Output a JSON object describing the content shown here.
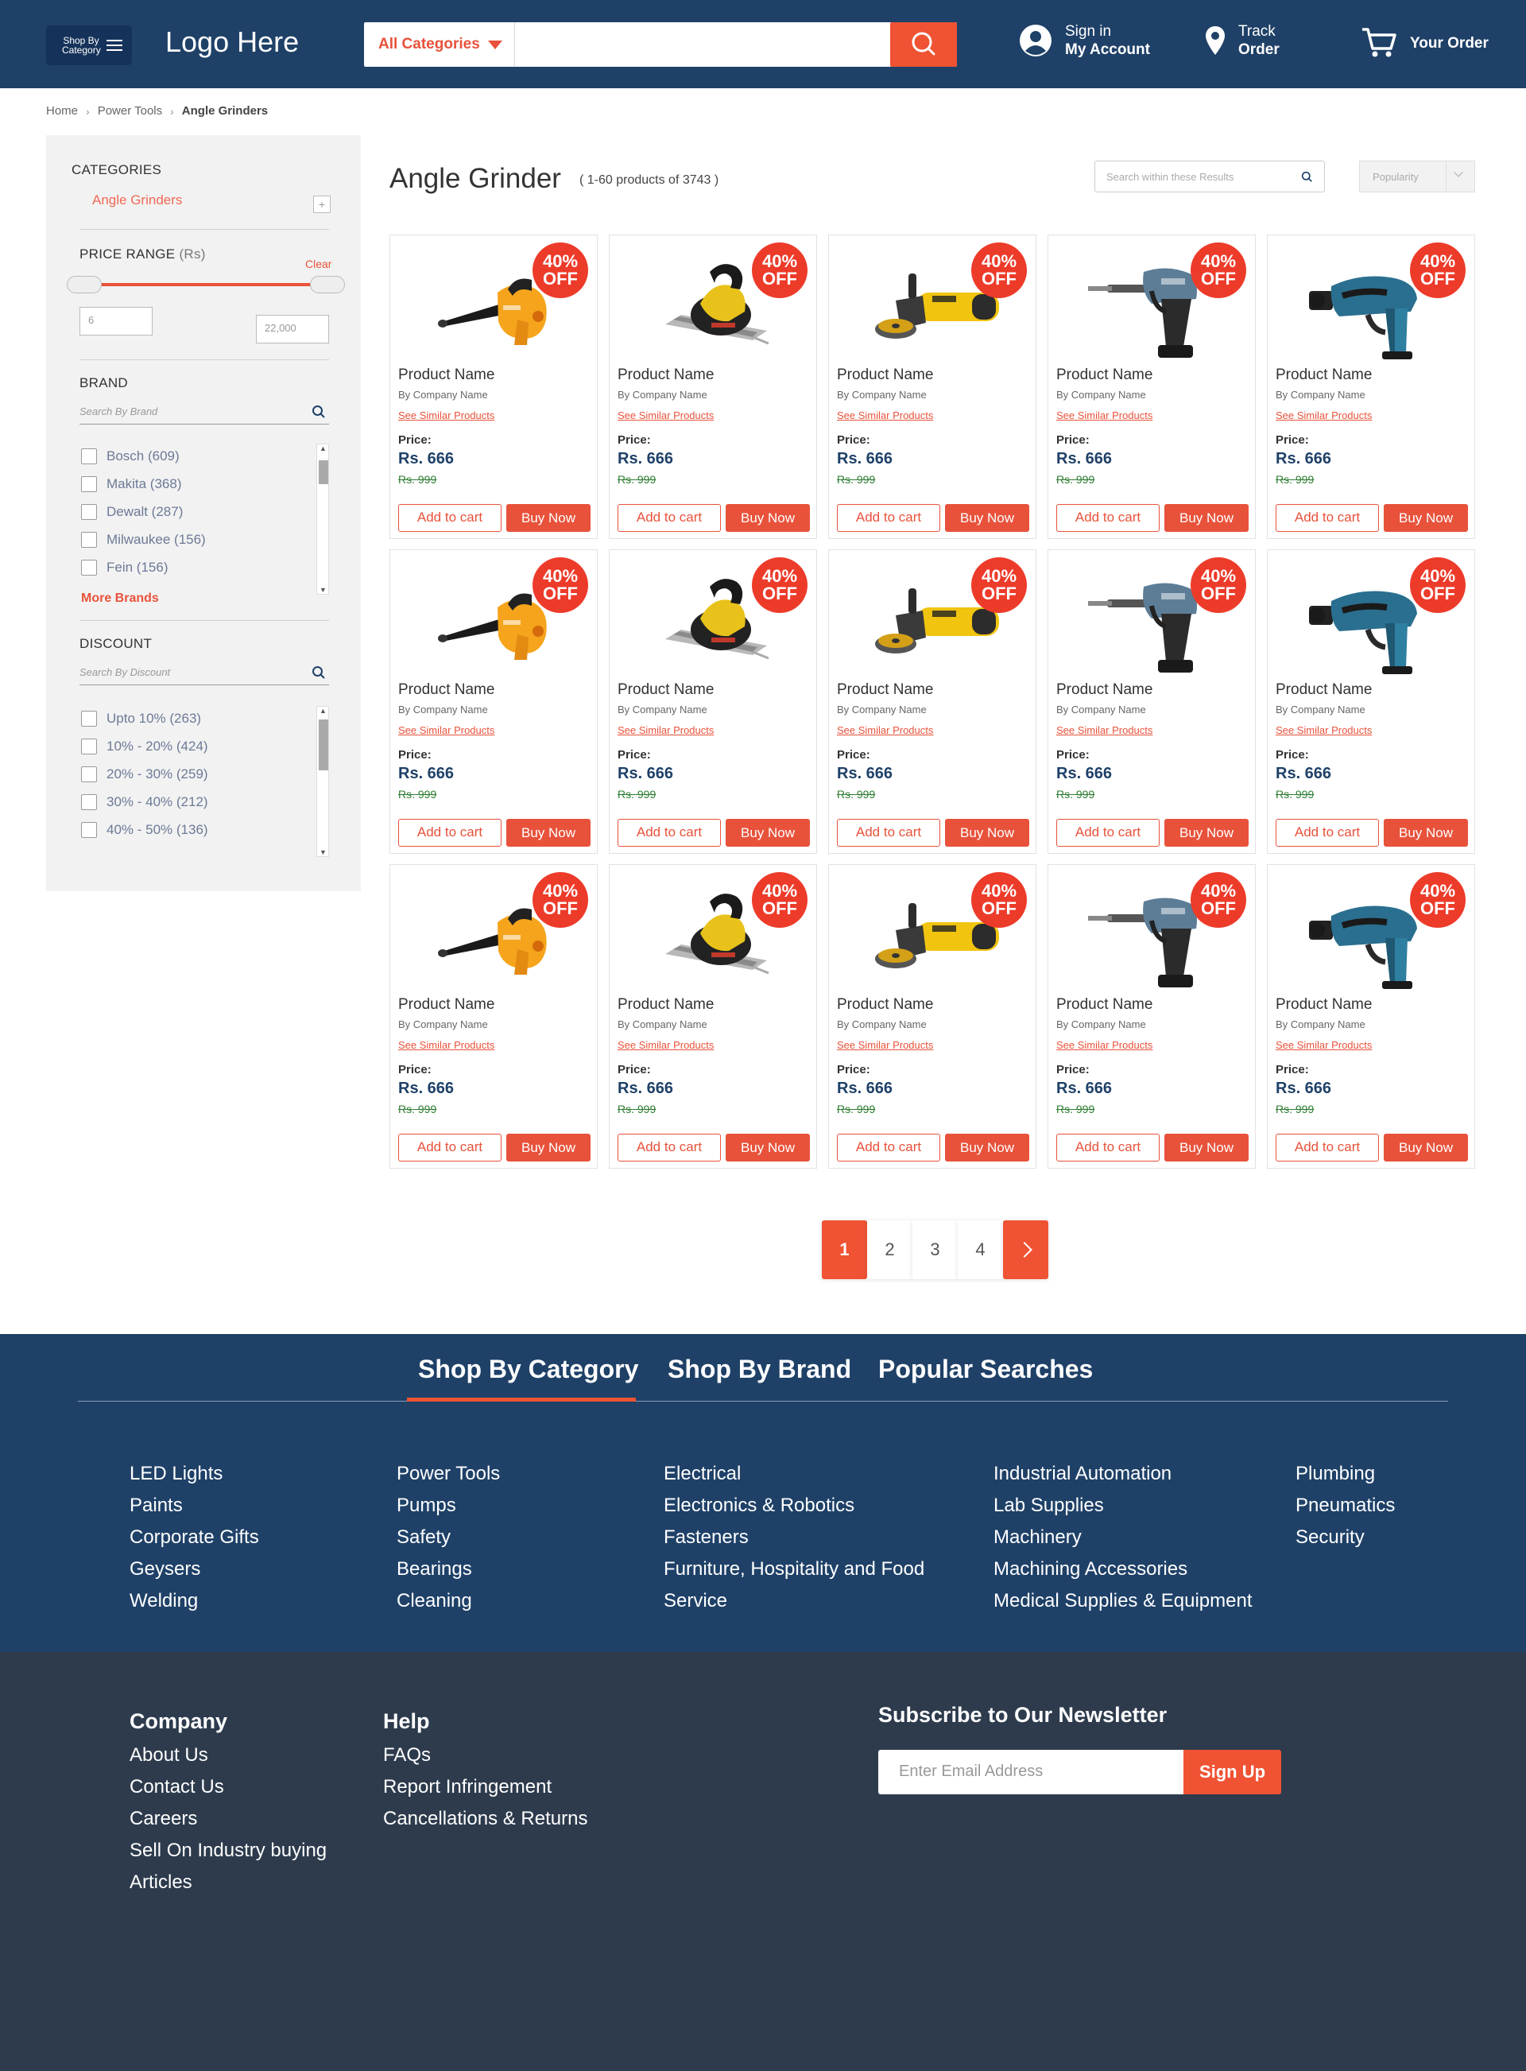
{
  "header": {
    "shop_by_category": "Shop By Category",
    "logo": "Logo Here",
    "category_dropdown": "All Categories",
    "search_value": "",
    "signin_line1": "Sign in",
    "signin_line2": "My Account",
    "track_line1": "Track",
    "track_line2": "Order",
    "your_order": "Your Order"
  },
  "breadcrumb": [
    "Home",
    "Power Tools",
    "Angle Grinders"
  ],
  "sidebar": {
    "categories_title": "CATEGORIES",
    "category_item": "Angle Grinders",
    "expand_glyph": "+",
    "price_title": "PRICE RANGE",
    "price_unit": "(Rs)",
    "clear": "Clear",
    "price_min": "6",
    "price_max": "22,000",
    "brand_title": "BRAND",
    "brand_search_placeholder": "Search By Brand",
    "brands": [
      "Bosch (609)",
      "Makita (368)",
      "Dewalt (287)",
      "Milwaukee (156)",
      "Fein (156)"
    ],
    "more_brands": "More Brands",
    "discount_title": "DISCOUNT",
    "discount_search_placeholder": "Search By Discount",
    "discounts": [
      "Upto 10% (263)",
      "10% - 20% (424)",
      "20% - 30% (259)",
      "30% - 40% (212)",
      "40% - 50% (136)"
    ]
  },
  "main": {
    "title": "Angle Grinder",
    "count": "( 1-60 products of 3743 )",
    "within_placeholder": "Search within  these Results",
    "sort_value": "Popularity"
  },
  "product": {
    "badge_line1": "40%",
    "badge_line2": "OFF",
    "name": "Product Name",
    "by": "By",
    "company": "Company Name",
    "similar": "See Similar Products",
    "price_label": "Price:",
    "price": "Rs. 666",
    "old_price": "Rs. 999",
    "add_to_cart": "Add to cart",
    "buy_now": "Buy Now"
  },
  "product_images": [
    "blower-icon",
    "circular-saw-icon",
    "angle-grinder-icon",
    "impact-driver-icon",
    "impact-wrench-icon"
  ],
  "pagination": {
    "pages": [
      "1",
      "2",
      "3",
      "4"
    ],
    "current": "1"
  },
  "footer_tabs": [
    "Shop By Category",
    "Shop By Brand",
    "Popular Searches"
  ],
  "footer_columns": [
    [
      "LED Lights",
      "Paints",
      "Corporate Gifts",
      "Geysers",
      "Welding"
    ],
    [
      "Power Tools",
      "Pumps",
      "Safety",
      "Bearings",
      "Cleaning"
    ],
    [
      "Electrical",
      "Electronics & Robotics",
      "Fasteners",
      "Furniture, Hospitality and Food",
      "Service"
    ],
    [
      "Industrial Automation",
      "Lab Supplies",
      "Machinery",
      "Machining Accessories",
      "Medical Supplies & Equipment"
    ],
    [
      "Plumbing",
      "Pneumatics",
      "Security"
    ]
  ],
  "footer_bottom": {
    "company_title": "Company",
    "company_links": [
      "About Us",
      "Contact Us",
      "Careers",
      "Sell On Industry buying",
      "Articles"
    ],
    "help_title": "Help",
    "help_links": [
      "FAQs",
      "Report Infringement",
      "Cancellations & Returns"
    ],
    "newsletter_title": "Subscribe to Our Newsletter",
    "email_placeholder": "Enter Email Address",
    "signup": "Sign Up"
  },
  "colors": {
    "navy": "#1f4168",
    "accent": "#ef5334",
    "footer_dark": "#2d3b4d"
  }
}
